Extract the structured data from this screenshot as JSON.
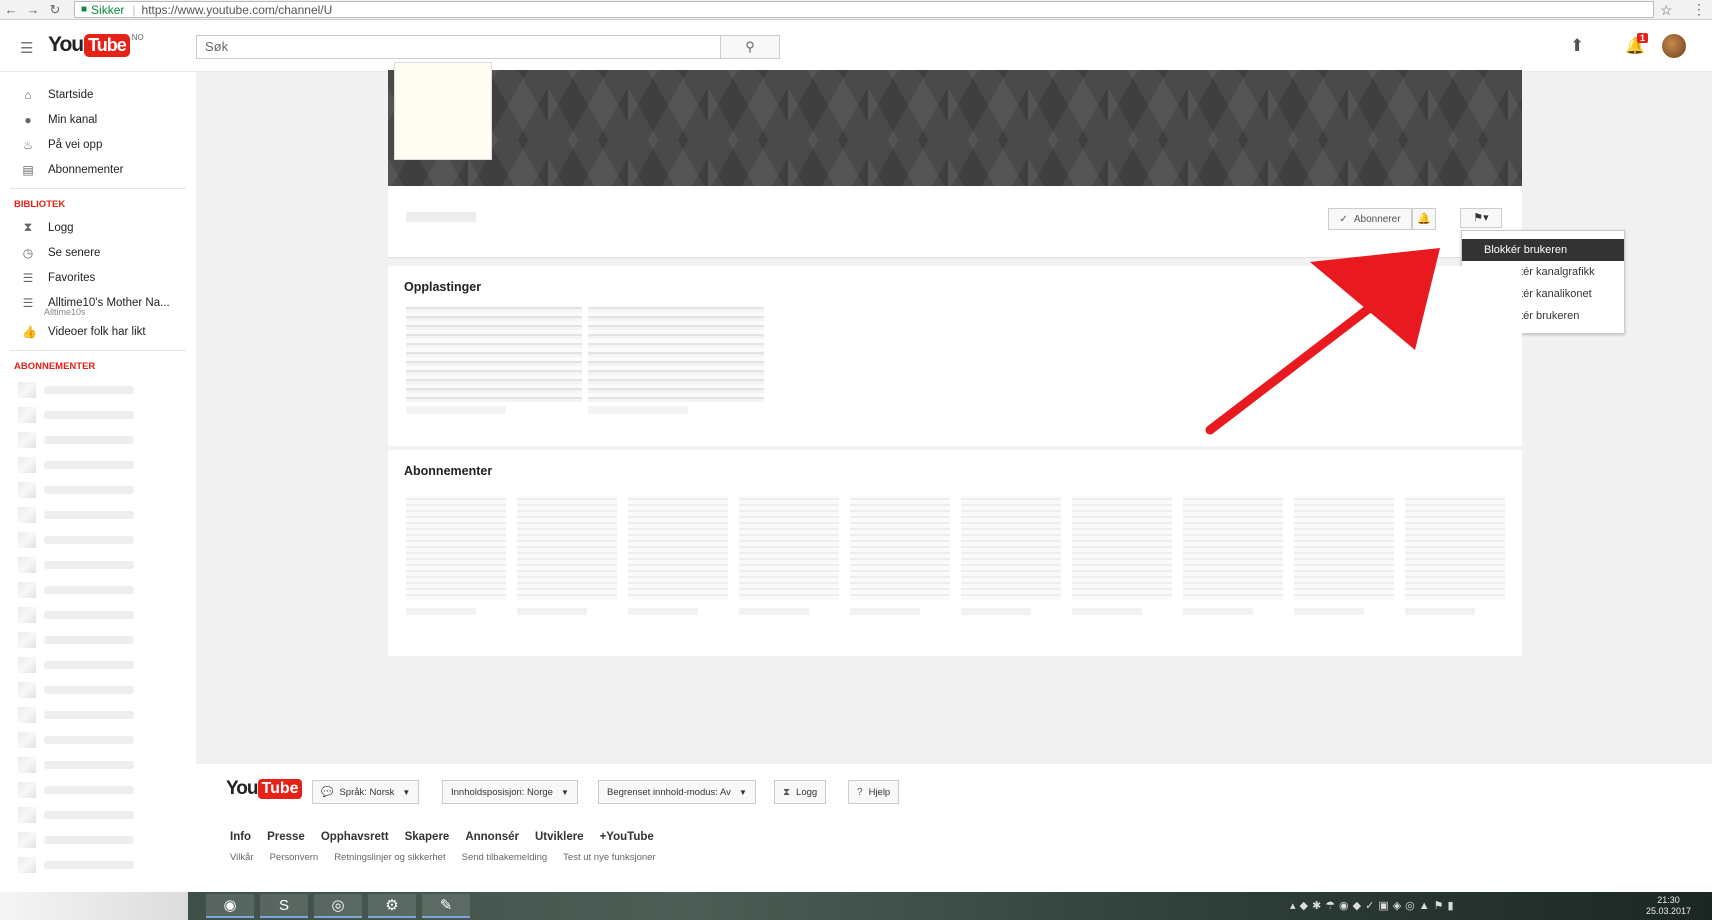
{
  "browser": {
    "secure_label": "Sikker",
    "url": "https://www.youtube.com/channel/U"
  },
  "masthead": {
    "logo_you": "You",
    "logo_tube": "Tube",
    "country": "NO",
    "search_placeholder": "Søk",
    "notif_count": "1"
  },
  "sidebar": {
    "main": [
      {
        "label": "Startside",
        "icon": "home-icon"
      },
      {
        "label": "Min kanal",
        "icon": "person-icon"
      },
      {
        "label": "På vei opp",
        "icon": "flame-icon"
      },
      {
        "label": "Abonnementer",
        "icon": "subscriptions-icon"
      }
    ],
    "library_heading": "BIBLIOTEK",
    "library": [
      {
        "label": "Logg",
        "icon": "hourglass-icon"
      },
      {
        "label": "Se senere",
        "icon": "clock-icon"
      },
      {
        "label": "Favorites",
        "icon": "playlist-icon"
      },
      {
        "label": "Alltime10's Mother Na...",
        "icon": "playlist-icon",
        "sub": "Alltime10s"
      },
      {
        "label": "Videoer folk har likt",
        "icon": "thumbs-up-icon"
      }
    ],
    "subs_heading": "ABONNEMENTER"
  },
  "channel": {
    "subscribe_label": "Abonnerer"
  },
  "dropdown": {
    "items": [
      "Blokkér brukeren",
      "Rapportér kanalgrafikk",
      "Rapportér kanalikonet",
      "Rapportér brukeren"
    ]
  },
  "sections": {
    "uploads": "Opplastinger",
    "subscriptions": "Abonnementer"
  },
  "footer": {
    "logo_you": "You",
    "logo_tube": "Tube",
    "language": "Språk: Norsk",
    "location": "Innholdsposisjon: Norge",
    "restricted": "Begrenset innhold-modus: Av",
    "history": "Logg",
    "help": "Hjelp",
    "links": [
      "Info",
      "Presse",
      "Opphavsrett",
      "Skapere",
      "Annonsér",
      "Utviklere",
      "+YouTube"
    ],
    "small_links": [
      "Vilkår",
      "Personvern",
      "Retningslinjer og sikkerhet",
      "Send tilbakemelding",
      "Test ut nye funksjoner"
    ]
  },
  "taskbar": {
    "time": "21:30",
    "date": "25.03.2017"
  },
  "colors": {
    "accent": "#e62117",
    "arrow": "#e8191f",
    "banner": "#4a4a4a"
  }
}
